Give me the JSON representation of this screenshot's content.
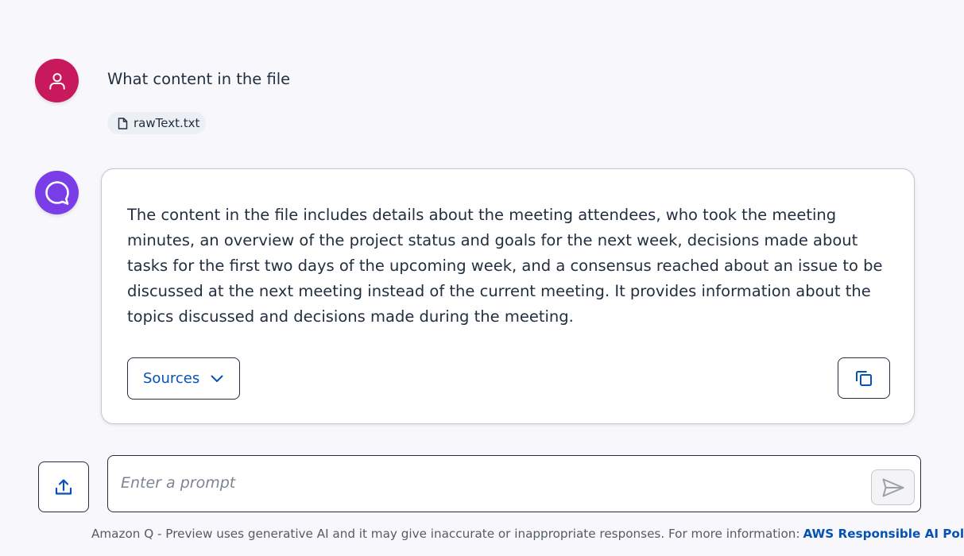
{
  "conversation": {
    "user_message": {
      "text": "What content in the file",
      "attachment": {
        "name": "rawText.txt",
        "icon": "file-icon"
      },
      "avatar_icon": "user-icon",
      "avatar_color": "#c7195c"
    },
    "assistant_message": {
      "text": "The content in the file includes details about the meeting attendees, who took the meeting minutes, an overview of the project status and goals for the next week, decisions made about tasks for the first two days of the upcoming week, and a consensus reached about an issue to be discussed at the next meeting instead of the current meeting. It provides information about the topics discussed and decisions made during the meeting.",
      "avatar_icon": "chat-bubble-icon",
      "avatar_color": "#7a3ee8",
      "sources_label": "Sources",
      "sources_icon": "chevron-down-icon",
      "copy_icon": "copy-icon"
    }
  },
  "composer": {
    "upload_icon": "upload-icon",
    "placeholder": "Enter a prompt",
    "value": "",
    "send_icon": "send-icon"
  },
  "footer": {
    "disclaimer": "Amazon Q - Preview uses generative AI and it may give inaccurate or inappropriate responses. For more information:",
    "policy_link": "AWS Responsible AI Policy",
    "policy_icon": "external-link-icon"
  },
  "colors": {
    "background": "#f8f8fc",
    "link": "#0552b5",
    "text": "#232f3e"
  }
}
